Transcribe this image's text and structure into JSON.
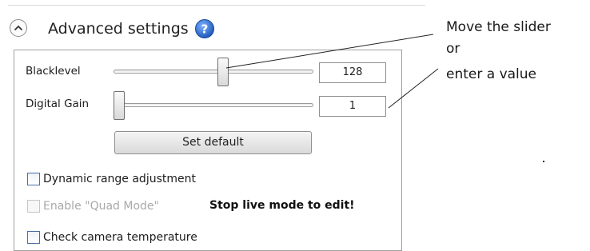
{
  "section": {
    "title": "Advanced settings",
    "collapse_icon": "chevron-up-icon",
    "help_icon": "help-icon"
  },
  "sliders": [
    {
      "label": "Blacklevel",
      "value": "128",
      "position_fraction": 0.55
    },
    {
      "label": "Digital Gain",
      "value": "1",
      "position_fraction": 0.0
    }
  ],
  "buttons": {
    "set_default": "Set default"
  },
  "checkboxes": [
    {
      "label": "Dynamic range adjustment",
      "checked": false,
      "enabled": true
    },
    {
      "label": "Enable \"Quad Mode\"",
      "checked": false,
      "enabled": false
    },
    {
      "label": "Check camera temperature",
      "checked": false,
      "enabled": true
    }
  ],
  "warning": "Stop live mode to edit!",
  "annotations": {
    "line1": "Move the slider",
    "line2": "or",
    "line3": "enter a value"
  },
  "colors": {
    "help_icon_fill": "#2f6fd0",
    "checkbox_border": "#4a6fa5"
  }
}
